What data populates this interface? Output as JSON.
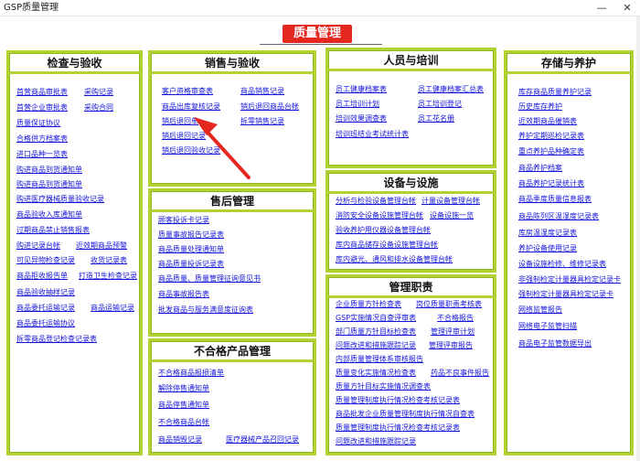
{
  "window": {
    "title": "GSP质量管理",
    "minimize": "—",
    "close": "✕"
  },
  "banner": {
    "title": "质量管理"
  },
  "panels": {
    "inspection": {
      "title": "检查与验收",
      "links": [
        "首营商品审批表",
        "采购记录",
        "首营企业审批表",
        "采购合同",
        "质量保证协议",
        "合格供方档案表",
        "进口品种一览表",
        "购进商品到货通知单",
        "购进商品到货通知单",
        "购进医疗器械质量验收记录",
        "商品验收入库通知单",
        "过期商品禁止销售报表",
        "购进记录台帐",
        "近效期商品预警",
        "可见异物检查记录",
        "收货记录表",
        "商品拒收报告单",
        "打造卫生检查记录",
        "商品验收抽样记录",
        "商品委托运输记录",
        "商品运输记录",
        "商品委托运输协议",
        "拆零商品登记检查记录表"
      ]
    },
    "sales": {
      "title": "销售与验收",
      "links": [
        "客户资格审查表",
        "商品销售记录",
        "商品出库复核记录",
        "销后退回商品台帐",
        "销后退回单",
        "拆零销售记录",
        "销后退回记录",
        "销后退回验收记录"
      ]
    },
    "aftersales": {
      "title": "售后管理",
      "links": [
        "顾客投诉卡记录",
        "质量事故报告记录表",
        "商品质量处理通知单",
        "商品质量投诉记录表",
        "商品质量、质量管理征询意见书",
        "商品事故报告表",
        "批发商品与服务满意度征询表"
      ]
    },
    "nonconforming": {
      "title": "不合格产品管理",
      "links": [
        "不合格商品报损清单",
        "解除停售通知单",
        "商品停售通知单",
        "不合格商品台帐",
        "商品销毁记录",
        "医疗器械产品召回记录"
      ]
    },
    "personnel": {
      "title": "人员与培训",
      "links": [
        "员工健康档案表",
        "员工健康档案汇总表",
        "员工培训计划",
        "员工培训登记",
        "培训效果调查表",
        "员工花名册",
        "培训班结业考试统计表"
      ]
    },
    "equipment": {
      "title": "设备与设施",
      "links": [
        "分析与检验设备管理台帐",
        "计量设备管理台帐",
        "消防安全设备设施管理台帐",
        "设备设施一览",
        "验收养护用仪器设备管理台帐",
        "库内商品储存设备设施管理台帐",
        "库内避光、通风和排水设备管理台帐"
      ]
    },
    "duties": {
      "title": "管理职责",
      "links": [
        "企业质量方针检查表",
        "岗位质量职责考核表",
        "GSP实施情况自查评审表",
        "不合格报告",
        "部门质量方针目标检查表",
        "管理评审计划",
        "问题改进和措施跟踪记录",
        "管理评审报告",
        "内部质量管理体系审核报告",
        "质量变化实施情况检查表",
        "药品不良事件报告",
        "质量方针目标实施情况调查表",
        "质量管理制度执行情况检查考核记录表",
        "商品批发企业质量管理制度执行情况自查表",
        "质量管理制度执行情况检查考核记录表",
        "问题改进和措施跟踪记录"
      ]
    },
    "storage": {
      "title": "存储与养护",
      "links": [
        "库存商品质量养护记录",
        "历史库存养护",
        "近效期商品催销表",
        "养护定期巡检记录表",
        "重点养护品种确定表",
        "商品养护档案",
        "商品养护记录统计表",
        "商品季度质量信息报表",
        "商品陈列区温湿度记录表",
        "库房温湿度记录表",
        "养护设备使用记录",
        "设备设施检修、维修记录表",
        "非强制检定计量器具检定记录卡",
        "强制检定计量器具检定记录卡",
        "网络监管报告",
        "网络电子监管扫描",
        "商品电子监管数据导出"
      ]
    }
  }
}
